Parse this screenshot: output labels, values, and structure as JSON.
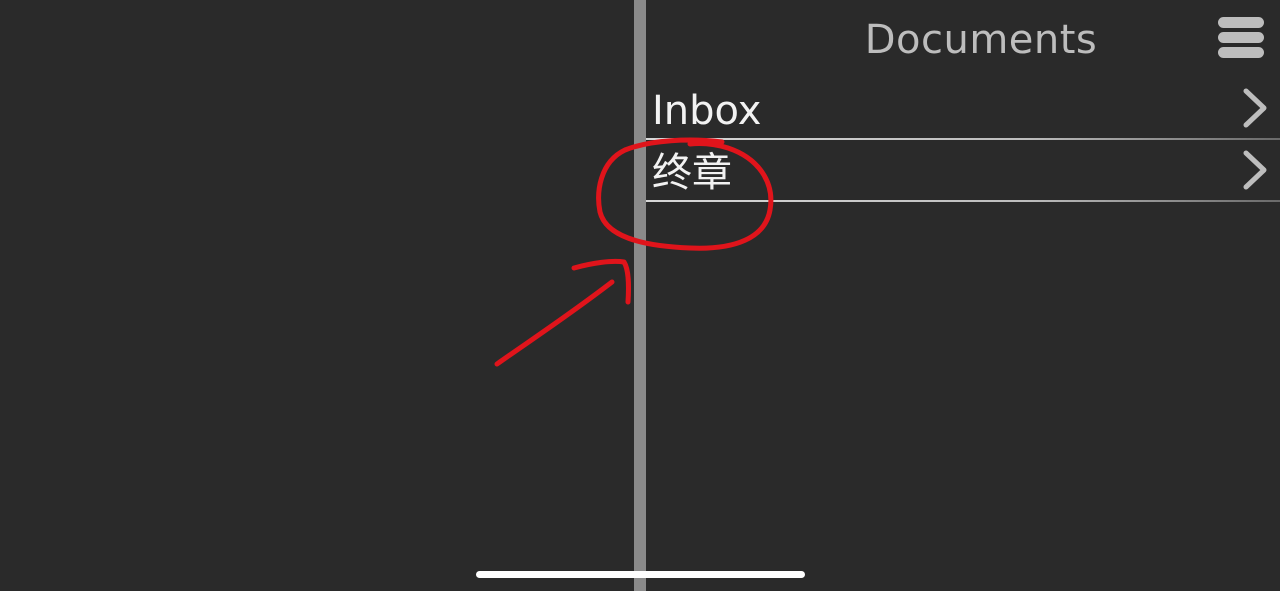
{
  "header": {
    "title": "Documents",
    "menu_icon": "hamburger-menu-icon"
  },
  "list": {
    "items": [
      {
        "label": "Inbox",
        "icon": "chevron-right-icon"
      },
      {
        "label": "终章",
        "icon": "chevron-right-icon"
      }
    ]
  },
  "annotation": {
    "color": "#e0141b",
    "shapes": [
      "circle",
      "arrow"
    ]
  },
  "colors": {
    "background": "#2a2a2a",
    "divider": "#8a8a8a",
    "title": "#bdbdbd",
    "item_text": "#f2f2f2",
    "home_indicator": "#ffffff"
  }
}
